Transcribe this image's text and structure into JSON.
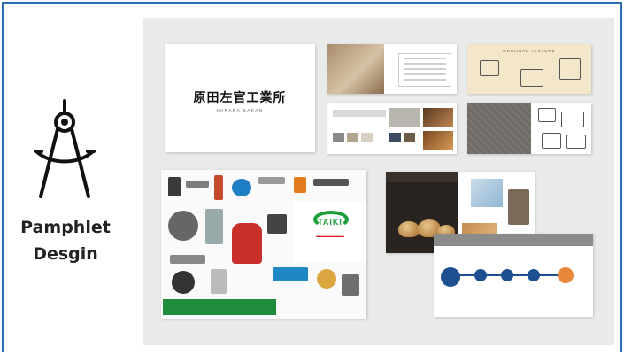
{
  "title": {
    "line1": "Pamphlet",
    "line2": "Desgin"
  },
  "icons": {
    "compass": "compass-icon"
  },
  "colors": {
    "frame": "#2d6bb3",
    "panel": "#e9eaea",
    "taiki_green": "#1e9f3c"
  },
  "thumbnails": {
    "harada": {
      "name": "原田左官工業所",
      "romaji": "HARADA SAKAN"
    },
    "texture": {
      "label": "ORIGINAL TEXTURE"
    },
    "taiki": {
      "brand": "TAIKI"
    }
  }
}
